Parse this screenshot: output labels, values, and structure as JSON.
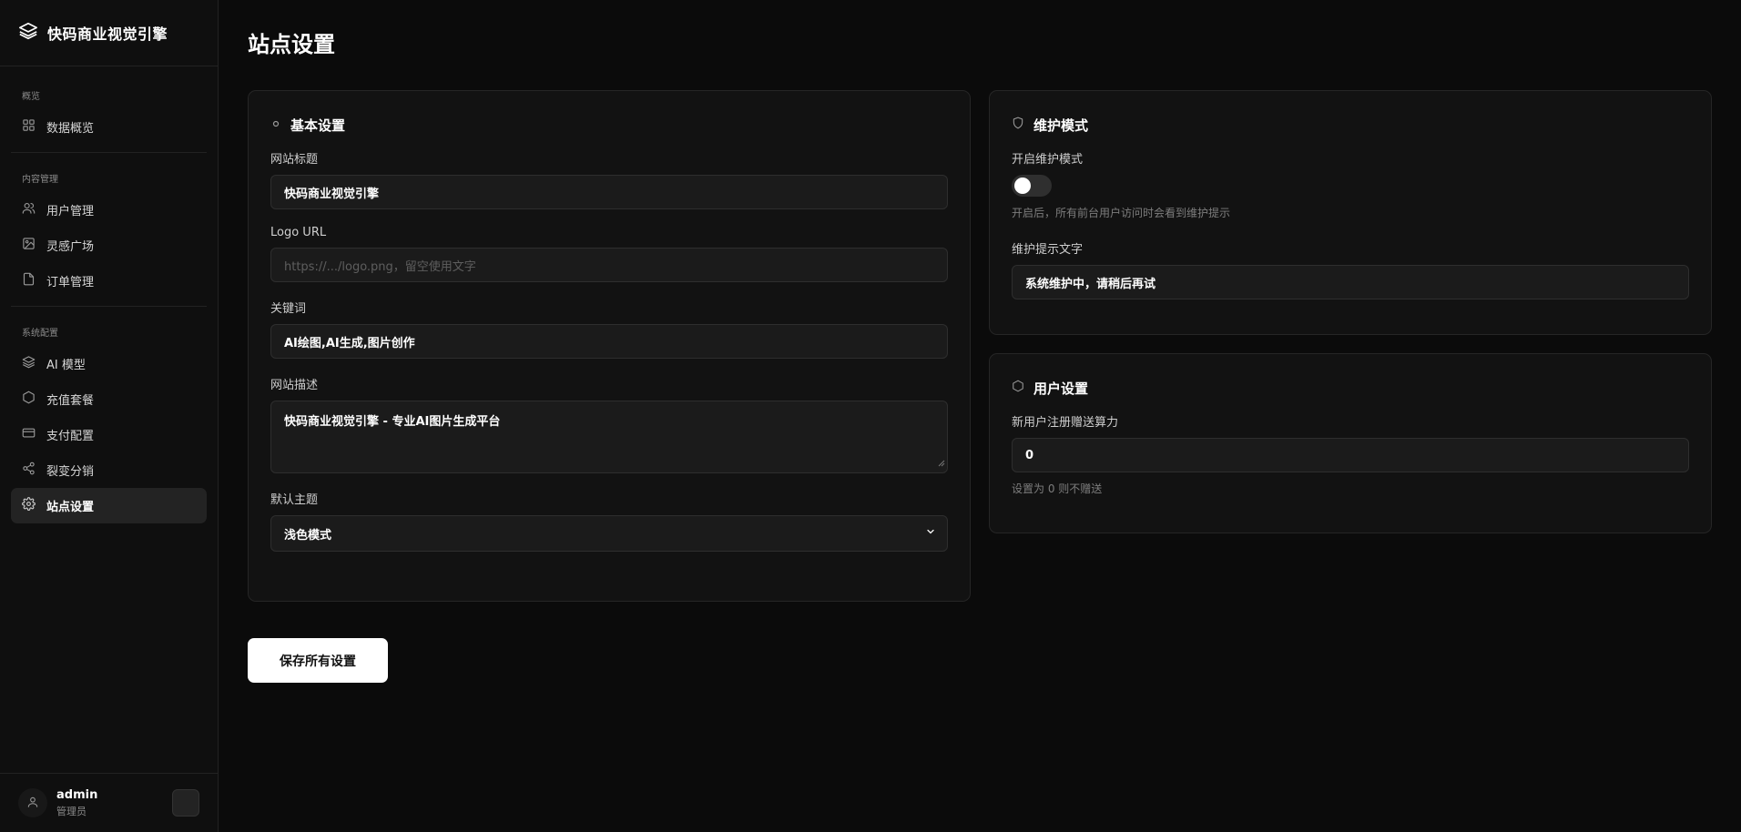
{
  "brand": {
    "name": "快码商业视觉引擎",
    "icon": "layers-icon"
  },
  "sidebar": {
    "groups": [
      {
        "title": "概览",
        "items": [
          {
            "label": "数据概览",
            "icon": "grid-icon"
          }
        ]
      },
      {
        "title": "内容管理",
        "items": [
          {
            "label": "用户管理",
            "icon": "users-icon"
          },
          {
            "label": "灵感广场",
            "icon": "image-icon"
          },
          {
            "label": "订单管理",
            "icon": "file-icon"
          }
        ]
      },
      {
        "title": "系统配置",
        "items": [
          {
            "label": "AI 模型",
            "icon": "layers-icon"
          },
          {
            "label": "充值套餐",
            "icon": "hexagon-icon"
          },
          {
            "label": "支付配置",
            "icon": "card-icon"
          },
          {
            "label": "裂变分销",
            "icon": "share-icon"
          },
          {
            "label": "站点设置",
            "icon": "gear-icon",
            "active": true
          }
        ]
      }
    ],
    "user": {
      "name": "admin",
      "role": "管理员"
    }
  },
  "page": {
    "title": "站点设置"
  },
  "basic": {
    "title": "基本设置",
    "site_title_label": "网站标题",
    "site_title_value": "快码商业视觉引擎",
    "logo_label": "Logo URL",
    "logo_placeholder": "https://.../logo.png，留空使用文字",
    "keywords_label": "关键词",
    "keywords_value": "AI绘图,AI生成,图片创作",
    "desc_label": "网站描述",
    "desc_value": "快码商业视觉引擎 - 专业AI图片生成平台",
    "theme_label": "默认主题",
    "theme_value": "浅色模式"
  },
  "maintenance": {
    "title": "维护模式",
    "toggle_label": "开启维护模式",
    "toggle_on": false,
    "toggle_hint": "开启后，所有前台用户访问时会看到维护提示",
    "text_label": "维护提示文字",
    "text_value": "系统维护中，请稍后再试"
  },
  "user_settings": {
    "title": "用户设置",
    "gift_label": "新用户注册赠送算力",
    "gift_value": "0",
    "gift_hint": "设置为 0 则不赠送"
  },
  "actions": {
    "save_label": "保存所有设置"
  }
}
